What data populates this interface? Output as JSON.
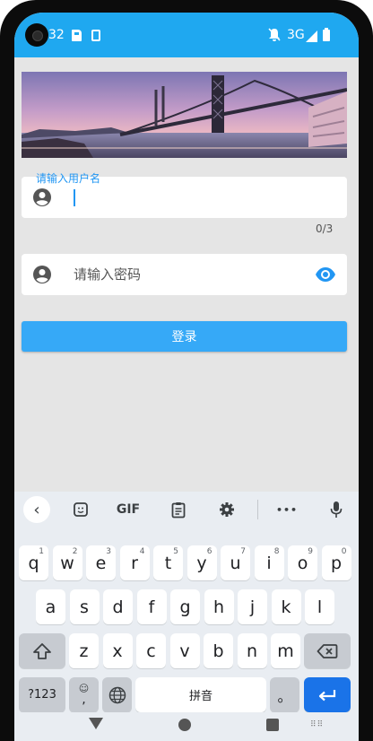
{
  "status_bar": {
    "time": "32",
    "network": "3G",
    "icons": [
      "camera-icon",
      "sd-card-icon",
      "sim-icon",
      "mute-icon",
      "signal-icon",
      "battery-icon"
    ]
  },
  "form": {
    "username": {
      "label": "请输入用户名",
      "value": "",
      "counter": "0/3",
      "icon": "account-circle-icon"
    },
    "password": {
      "placeholder": "请输入密码",
      "icon": "account-circle-icon",
      "toggle_icon": "eye-icon"
    },
    "login_button": "登录"
  },
  "keyboard": {
    "toolbar": {
      "gif": "GIF",
      "more": "•••",
      "icons": [
        "back-icon",
        "sticker-icon",
        "clipboard-icon",
        "gear-icon",
        "mic-icon"
      ]
    },
    "row1": [
      {
        "key": "q",
        "hint": "1"
      },
      {
        "key": "w",
        "hint": "2"
      },
      {
        "key": "e",
        "hint": "3"
      },
      {
        "key": "r",
        "hint": "4"
      },
      {
        "key": "t",
        "hint": "5"
      },
      {
        "key": "y",
        "hint": "6"
      },
      {
        "key": "u",
        "hint": "7"
      },
      {
        "key": "i",
        "hint": "8"
      },
      {
        "key": "o",
        "hint": "9"
      },
      {
        "key": "p",
        "hint": "0"
      }
    ],
    "row2": [
      "a",
      "s",
      "d",
      "f",
      "g",
      "h",
      "j",
      "k",
      "l"
    ],
    "row3": [
      "z",
      "x",
      "c",
      "v",
      "b",
      "n",
      "m"
    ],
    "row4": {
      "symbols": "?123",
      "comma": ",",
      "space": "拼音",
      "period": "。"
    }
  },
  "colors": {
    "accent": "#1fa8f0",
    "button": "#36a9f7",
    "label": "#2196f3",
    "enter_key": "#1a73e8"
  }
}
